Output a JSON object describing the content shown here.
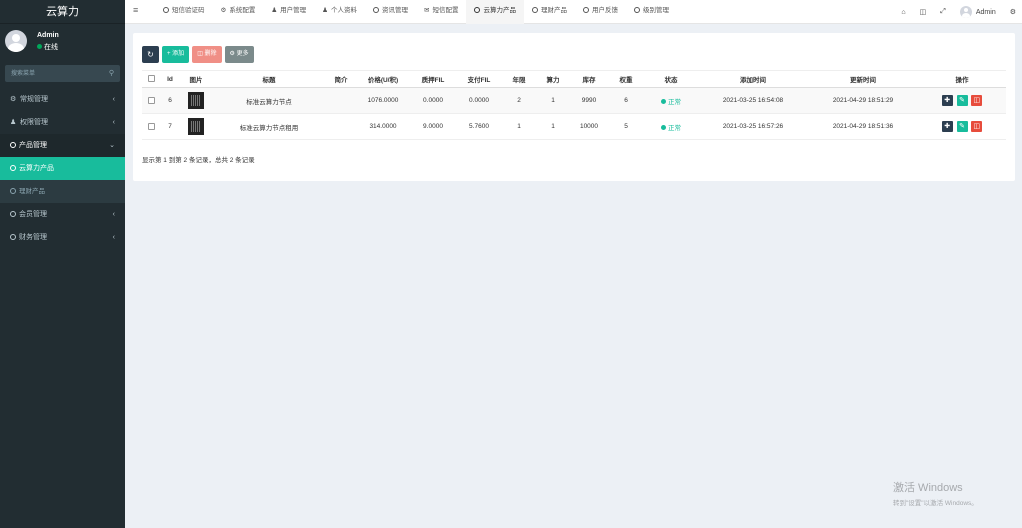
{
  "app": {
    "title": "云算力"
  },
  "user": {
    "name": "Admin",
    "status": "在线"
  },
  "search": {
    "placeholder": "搜索菜单"
  },
  "sidebar": {
    "items": [
      {
        "label": "常规管理",
        "icon": "cogs-icon"
      },
      {
        "label": "权限管理",
        "icon": "group-icon"
      },
      {
        "label": "产品管理",
        "icon": "circle-icon"
      },
      {
        "label": "云算力产品",
        "icon": "circle-icon"
      },
      {
        "label": "理财产品",
        "icon": "circle-icon"
      },
      {
        "label": "会员管理",
        "icon": "circle-icon"
      },
      {
        "label": "财务管理",
        "icon": "circle-icon"
      }
    ]
  },
  "topnav": {
    "tabs": [
      {
        "label": "短信验证码",
        "icon": "circle-icon"
      },
      {
        "label": "系统配置",
        "icon": "gear-icon"
      },
      {
        "label": "用户管理",
        "icon": "user-icon"
      },
      {
        "label": "个人资料",
        "icon": "user-icon"
      },
      {
        "label": "资讯管理",
        "icon": "circle-icon"
      },
      {
        "label": "短信配置",
        "icon": "envelope-icon"
      },
      {
        "label": "云算力产品",
        "icon": "circle-icon"
      },
      {
        "label": "理财产品",
        "icon": "circle-icon"
      },
      {
        "label": "用户反馈",
        "icon": "circle-icon"
      },
      {
        "label": "级别管理",
        "icon": "circle-icon"
      }
    ],
    "user_name": "Admin"
  },
  "toolbar": {
    "add_label": "添加",
    "delete_label": "删除",
    "more_label": "更多"
  },
  "table": {
    "headers": [
      "Id",
      "图片",
      "标题",
      "简介",
      "价格(U/积)",
      "质押FIL",
      "支付FIL",
      "年限",
      "算力",
      "库存",
      "权重",
      "状态",
      "添加时间",
      "更新时间",
      "操作"
    ],
    "rows": [
      {
        "id": "6",
        "title": "标准云算力节点",
        "intro": "",
        "price": "1076.0000",
        "pledge_fil": "0.0000",
        "pay_fil": "0.0000",
        "years": "2",
        "power": "1",
        "stock": "9990",
        "weight": "6",
        "status": "正常",
        "created": "2021-03-25 16:54:08",
        "updated": "2021-04-29 18:51:29"
      },
      {
        "id": "7",
        "title": "标准云算力节点租用",
        "intro": "",
        "price": "314.0000",
        "pledge_fil": "9.0000",
        "pay_fil": "5.7600",
        "years": "1",
        "power": "1",
        "stock": "10000",
        "weight": "5",
        "status": "正常",
        "created": "2021-03-25 16:57:26",
        "updated": "2021-04-29 18:51:36"
      }
    ]
  },
  "pagination": {
    "info": "显示第 1 到第 2 条记录，总共 2 条记录"
  },
  "watermark": {
    "line1": "激活 Windows",
    "line2": "转到\"设置\"以激活 Windows。"
  },
  "colors": {
    "sidebar_bg": "#222d32",
    "accent": "#18bc9c",
    "danger": "#e74c3c",
    "dark": "#2c3e50"
  }
}
